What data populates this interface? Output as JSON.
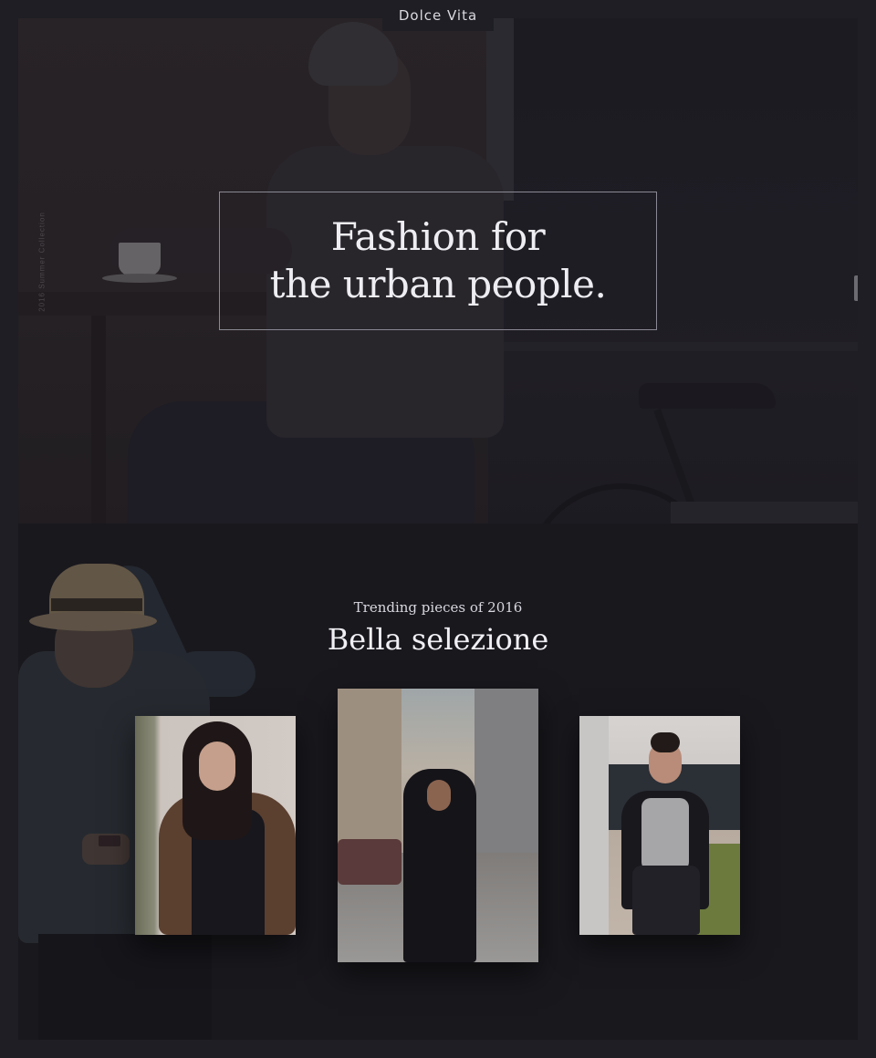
{
  "brand": {
    "name": "Dolce Vita"
  },
  "hero": {
    "side_label": "2016 Summer Collection",
    "headline_line1": "Fashion for",
    "headline_line2": "the urban people."
  },
  "trending": {
    "kicker": "Trending pieces of 2016",
    "title": "Bella selezione",
    "cards": [
      {
        "image": "woman-fur-vest-photo"
      },
      {
        "image": "man-black-cloak-street-photo"
      },
      {
        "image": "woman-blazer-leather-skirt-photo"
      }
    ]
  },
  "colors": {
    "page_background": "#1e1e24",
    "section_background": "#19181d",
    "headline_text": "#eeeef2",
    "headline_border": "#8a8893"
  }
}
